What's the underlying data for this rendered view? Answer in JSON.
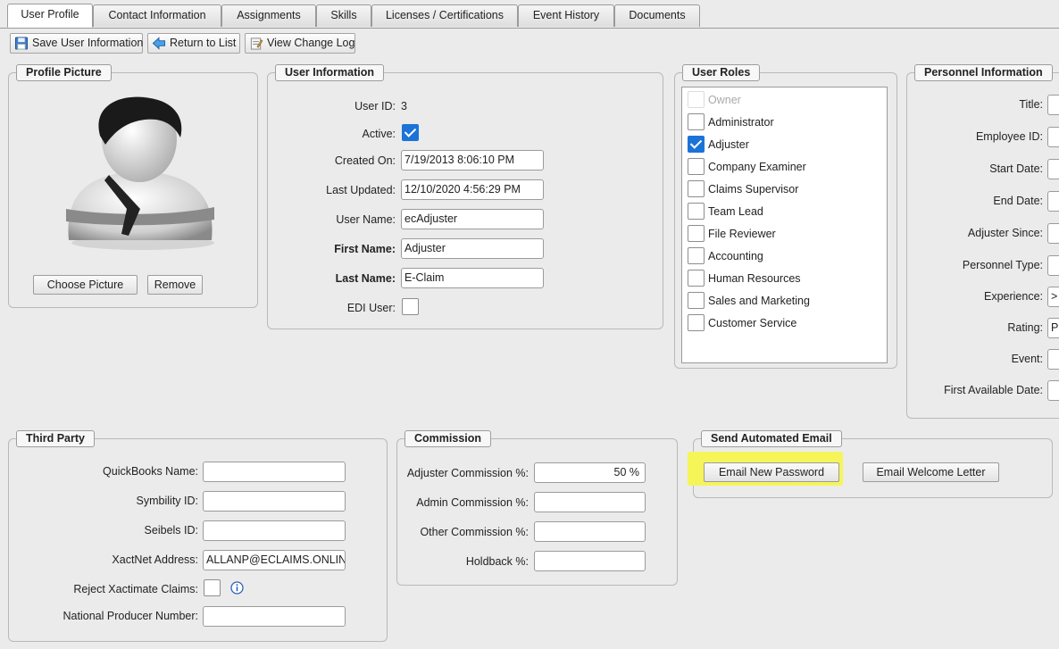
{
  "tabs": [
    {
      "label": "User Profile",
      "active": true
    },
    {
      "label": "Contact Information"
    },
    {
      "label": "Assignments"
    },
    {
      "label": "Skills"
    },
    {
      "label": "Licenses / Certifications"
    },
    {
      "label": "Event History"
    },
    {
      "label": "Documents"
    }
  ],
  "toolbar": {
    "save_label": "Save User Information",
    "return_label": "Return to List",
    "changelog_label": "View Change Log"
  },
  "profile_picture": {
    "title": "Profile Picture",
    "choose_label": "Choose Picture",
    "remove_label": "Remove"
  },
  "user_info": {
    "title": "User Information",
    "user_id_label": "User ID:",
    "user_id_value": "3",
    "active_label": "Active:",
    "active": true,
    "created_label": "Created On:",
    "created_value": "7/19/2013 8:06:10 PM",
    "updated_label": "Last Updated:",
    "updated_value": "12/10/2020 4:56:29 PM",
    "username_label": "User Name:",
    "username_value": "ecAdjuster",
    "firstname_label": "First Name:",
    "firstname_value": "Adjuster",
    "lastname_label": "Last Name:",
    "lastname_value": "E-Claim",
    "edi_label": "EDI User:",
    "edi": false
  },
  "user_roles": {
    "title": "User Roles",
    "items": [
      {
        "label": "Owner",
        "checked": false,
        "disabled": true
      },
      {
        "label": "Administrator",
        "checked": false
      },
      {
        "label": "Adjuster",
        "checked": true
      },
      {
        "label": "Company Examiner",
        "checked": false
      },
      {
        "label": "Claims Supervisor",
        "checked": false
      },
      {
        "label": "Team Lead",
        "checked": false
      },
      {
        "label": "File Reviewer",
        "checked": false
      },
      {
        "label": "Accounting",
        "checked": false
      },
      {
        "label": "Human Resources",
        "checked": false
      },
      {
        "label": "Sales and Marketing",
        "checked": false
      },
      {
        "label": "Customer Service",
        "checked": false
      }
    ]
  },
  "personnel": {
    "title": "Personnel Information",
    "fields": [
      {
        "label": "Title:",
        "value": ""
      },
      {
        "label": "Employee ID:",
        "value": ""
      },
      {
        "label": "Start Date:",
        "value": ""
      },
      {
        "label": "End Date:",
        "value": ""
      },
      {
        "label": "Adjuster Since:",
        "value": ""
      },
      {
        "label": "Personnel Type:",
        "value": ""
      },
      {
        "label": "Experience:",
        "value": ">"
      },
      {
        "label": "Rating:",
        "value": "Pr"
      },
      {
        "label": "Event:",
        "value": ""
      },
      {
        "label": "First Available Date:",
        "value": ""
      }
    ]
  },
  "third_party": {
    "title": "Third Party",
    "quickbooks_label": "QuickBooks Name:",
    "quickbooks_value": "",
    "symbility_label": "Symbility ID:",
    "symbility_value": "",
    "seibels_label": "Seibels ID:",
    "seibels_value": "",
    "xactnet_label": "XactNet Address:",
    "xactnet_value": "ALLANP@ECLAIMS.ONLINE.T",
    "reject_label": "Reject Xactimate Claims:",
    "reject": false,
    "npn_label": "National Producer Number:",
    "npn_value": ""
  },
  "commission": {
    "title": "Commission",
    "adjuster_label": "Adjuster Commission %:",
    "adjuster_value": "50 %",
    "admin_label": "Admin Commission %:",
    "admin_value": "",
    "other_label": "Other Commission %:",
    "other_value": "",
    "holdback_label": "Holdback %:",
    "holdback_value": ""
  },
  "email": {
    "title": "Send Automated Email",
    "new_password_label": "Email New Password",
    "welcome_label": "Email Welcome Letter"
  },
  "colors": {
    "highlight": "#f5f55a",
    "check_blue": "#1b73d8"
  }
}
